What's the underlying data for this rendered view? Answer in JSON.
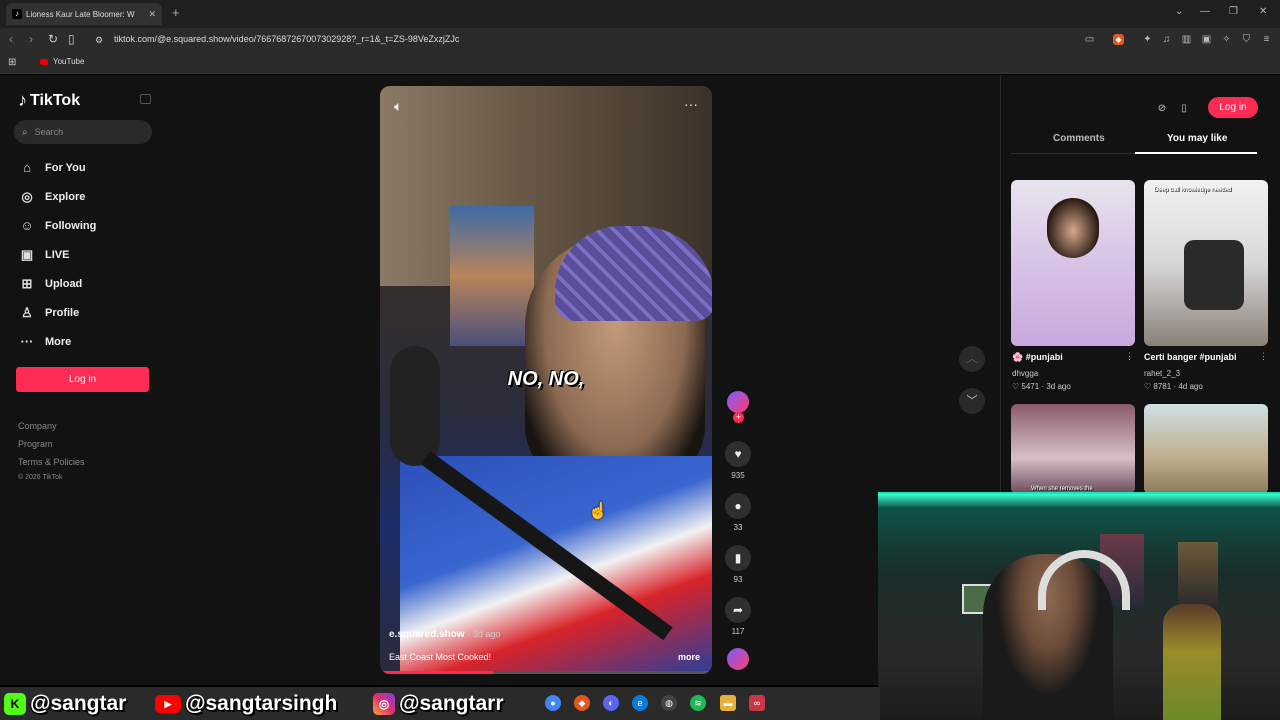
{
  "browser": {
    "tab_title": "Lioness Kaur Late Bloomer: W",
    "url": "tiktok.com/@e.squared.show/video/7667687267007302928?_r=1&_t=ZS-98VeZxzjZJc",
    "bookmark_label": "YouTube",
    "new_tab": "+",
    "icons": [
      "back-icon",
      "forward-icon",
      "reload-icon",
      "bookmark-icon",
      "site-info-icon",
      "brave-shield-icon",
      "extensions-icon",
      "sidebar-icon",
      "wallet-icon",
      "menu-icon"
    ]
  },
  "sidebar": {
    "logo": "TikTok",
    "search_placeholder": "Search",
    "nav": [
      {
        "label": "For You",
        "icon": "home-icon"
      },
      {
        "label": "Explore",
        "icon": "compass-icon"
      },
      {
        "label": "Following",
        "icon": "user-plus-icon"
      },
      {
        "label": "LIVE",
        "icon": "live-icon"
      },
      {
        "label": "Upload",
        "icon": "plus-square-icon"
      },
      {
        "label": "Profile",
        "icon": "person-icon"
      },
      {
        "label": "More",
        "icon": "ellipsis-icon"
      }
    ],
    "login_label": "Log in",
    "footer": [
      "Company",
      "Program",
      "Terms & Policies",
      "© 2026 TikTok"
    ]
  },
  "video": {
    "caption_overlay": "NO, NO,",
    "author": "e.squared.show",
    "age": "· 3d ago",
    "description": "East Coast Most Cooked!",
    "more_label": "more",
    "progress": 0.34,
    "likes": "935",
    "comments": "33",
    "saves": "93",
    "shares": "117"
  },
  "right_panel": {
    "login_label": "Log in",
    "tabs": [
      "Comments",
      "You may like"
    ],
    "active_tab": "You may like",
    "cards": [
      {
        "title": "🌸 #punjabi",
        "user": "dhvgga",
        "likes": "5471",
        "age": "· 3d ago",
        "thumb_text": ""
      },
      {
        "title": "Certi banger #punjabi",
        "user": "rahet_2_3",
        "likes": "8781",
        "age": "· 4d ago",
        "thumb_text": "Deep ball knowledge needed"
      },
      {
        "title": "",
        "user": "",
        "likes": "",
        "age": "",
        "thumb_text": "When she removes the"
      },
      {
        "title": "",
        "user": "",
        "likes": "",
        "age": "",
        "thumb_text": ""
      }
    ]
  },
  "stream_banner": {
    "kick": "@sangtar",
    "youtube": "@sangtarsingh",
    "instagram": "@sangtarr"
  },
  "colors": {
    "accent": "#fe2c55",
    "page_bg": "#121212",
    "cam_glow": "#1fe3b4"
  }
}
